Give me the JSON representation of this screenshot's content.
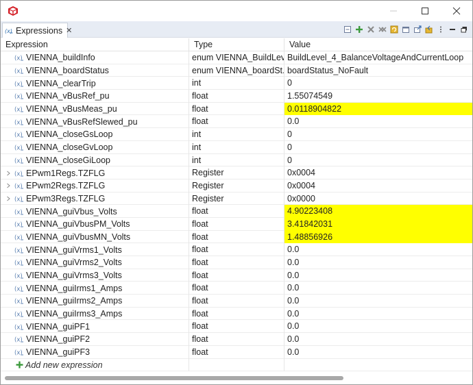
{
  "window": {
    "app_icon": "ccs-cube-icon",
    "controls": {
      "minimize": "minimize-icon",
      "maximize": "maximize-icon",
      "close": "close-icon"
    }
  },
  "tab": {
    "label": "Expressions",
    "icon": "expressions-icon",
    "close": "✕"
  },
  "toolbar": {
    "buttons": [
      "collapse-all-icon",
      "add-expression-icon",
      "remove-icon",
      "remove-all-icon",
      "refresh-icon",
      "new-watch-icon",
      "export-icon",
      "import-icon",
      "view-menu-icon",
      "minimize-view-icon",
      "maximize-view-icon"
    ]
  },
  "columns": {
    "expression": "Expression",
    "type": "Type",
    "value": "Value"
  },
  "rows": [
    {
      "name": "VIENNA_buildInfo",
      "type": "enum VIENNA_BuildLev...",
      "value": "BuildLevel_4_BalanceVoltageAndCurrentLoop",
      "highlight": false,
      "expandable": false
    },
    {
      "name": "VIENNA_boardStatus",
      "type": "enum VIENNA_boardSt...",
      "value": "boardStatus_NoFault",
      "highlight": false,
      "expandable": false
    },
    {
      "name": "VIENNA_clearTrip",
      "type": "int",
      "value": "0",
      "highlight": false,
      "expandable": false
    },
    {
      "name": "VIENNA_vBusRef_pu",
      "type": "float",
      "value": "1.55074549",
      "highlight": false,
      "expandable": false
    },
    {
      "name": "VIENNA_vBusMeas_pu",
      "type": "float",
      "value": "0.0118904822",
      "highlight": true,
      "expandable": false
    },
    {
      "name": "VIENNA_vBusRefSlewed_pu",
      "type": "float",
      "value": "0.0",
      "highlight": false,
      "expandable": false
    },
    {
      "name": "VIENNA_closeGsLoop",
      "type": "int",
      "value": "0",
      "highlight": false,
      "expandable": false
    },
    {
      "name": "VIENNA_closeGvLoop",
      "type": "int",
      "value": "0",
      "highlight": false,
      "expandable": false
    },
    {
      "name": "VIENNA_closeGiLoop",
      "type": "int",
      "value": "0",
      "highlight": false,
      "expandable": false
    },
    {
      "name": "EPwm1Regs.TZFLG",
      "type": "Register",
      "value": "0x0004",
      "highlight": false,
      "expandable": true
    },
    {
      "name": "EPwm2Regs.TZFLG",
      "type": "Register",
      "value": "0x0004",
      "highlight": false,
      "expandable": true
    },
    {
      "name": "EPwm3Regs.TZFLG",
      "type": "Register",
      "value": "0x0000",
      "highlight": false,
      "expandable": true
    },
    {
      "name": "VIENNA_guiVbus_Volts",
      "type": "float",
      "value": "4.90223408",
      "highlight": true,
      "expandable": false
    },
    {
      "name": "VIENNA_guiVbusPM_Volts",
      "type": "float",
      "value": "3.41842031",
      "highlight": true,
      "expandable": false
    },
    {
      "name": "VIENNA_guiVbusMN_Volts",
      "type": "float",
      "value": "1.48856926",
      "highlight": true,
      "expandable": false
    },
    {
      "name": "VIENNA_guiVrms1_Volts",
      "type": "float",
      "value": "0.0",
      "highlight": false,
      "expandable": false
    },
    {
      "name": "VIENNA_guiVrms2_Volts",
      "type": "float",
      "value": "0.0",
      "highlight": false,
      "expandable": false
    },
    {
      "name": "VIENNA_guiVrms3_Volts",
      "type": "float",
      "value": "0.0",
      "highlight": false,
      "expandable": false
    },
    {
      "name": "VIENNA_guiIrms1_Amps",
      "type": "float",
      "value": "0.0",
      "highlight": false,
      "expandable": false
    },
    {
      "name": "VIENNA_guiIrms2_Amps",
      "type": "float",
      "value": "0.0",
      "highlight": false,
      "expandable": false
    },
    {
      "name": "VIENNA_guiIrms3_Amps",
      "type": "float",
      "value": "0.0",
      "highlight": false,
      "expandable": false
    },
    {
      "name": "VIENNA_guiPF1",
      "type": "float",
      "value": "0.0",
      "highlight": false,
      "expandable": false
    },
    {
      "name": "VIENNA_guiPF2",
      "type": "float",
      "value": "0.0",
      "highlight": false,
      "expandable": false
    },
    {
      "name": "VIENNA_guiPF3",
      "type": "float",
      "value": "0.0",
      "highlight": false,
      "expandable": false
    }
  ],
  "add_row": {
    "label": "Add new expression",
    "icon": "plus-icon"
  },
  "colors": {
    "highlight": "#ffff00",
    "tab_bar": "#e7ecf4",
    "variable_icon": "#5a7fb0",
    "add_icon": "#3c9a3c"
  }
}
